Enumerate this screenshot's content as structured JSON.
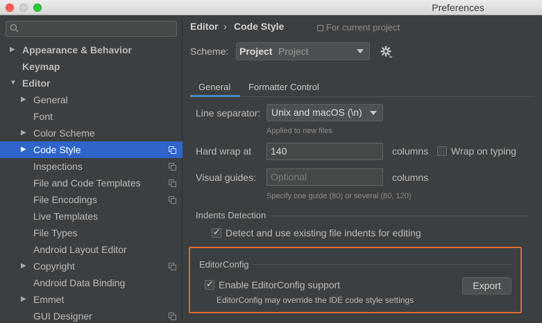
{
  "window": {
    "title": "Preferences"
  },
  "sidebar": {
    "search_placeholder": "",
    "items": [
      {
        "label": "Appearance & Behavior",
        "arrow": "▶",
        "bold": true
      },
      {
        "label": "Keymap",
        "bold": true
      },
      {
        "label": "Editor",
        "arrow": "▼",
        "bold": true
      },
      {
        "label": "General",
        "arrow": "▶"
      },
      {
        "label": "Font"
      },
      {
        "label": "Color Scheme",
        "arrow": "▶"
      },
      {
        "label": "Code Style",
        "arrow": "▶",
        "selected": true,
        "copy_icon": "copy-icon"
      },
      {
        "label": "Inspections",
        "copy_icon": "copy-icon"
      },
      {
        "label": "File and Code Templates",
        "copy_icon": "copy-icon"
      },
      {
        "label": "File Encodings",
        "copy_icon": "copy-icon"
      },
      {
        "label": "Live Templates"
      },
      {
        "label": "File Types"
      },
      {
        "label": "Android Layout Editor"
      },
      {
        "label": "Copyright",
        "arrow": "▶",
        "copy_icon": "copy-icon"
      },
      {
        "label": "Android Data Binding"
      },
      {
        "label": "Emmet",
        "arrow": "▶"
      },
      {
        "label": "GUI Designer",
        "copy_icon": "copy-icon"
      }
    ]
  },
  "header": {
    "breadcrumb_1": "Editor",
    "breadcrumb_sep": "›",
    "breadcrumb_2": "Code Style",
    "project_note": "For current project"
  },
  "scheme": {
    "label": "Scheme:",
    "value_bold": "Project",
    "value_sub": "Project"
  },
  "tabs": [
    {
      "label": "General",
      "active": true
    },
    {
      "label": "Formatter Control",
      "active": false
    }
  ],
  "general": {
    "line_separator_label": "Line separator:",
    "line_separator_value": "Unix and macOS (\\n)",
    "line_separator_hint": "Applied to new files",
    "hard_wrap_label": "Hard wrap at",
    "hard_wrap_value": "140",
    "hard_wrap_unit": "columns",
    "wrap_on_typing_label": "Wrap on typing",
    "wrap_on_typing_checked": false,
    "visual_guides_label": "Visual guides:",
    "visual_guides_placeholder": "Optional",
    "visual_guides_unit": "columns",
    "visual_guides_hint": "Specify one guide (80) or several (80, 120)",
    "indents_section": "Indents Detection",
    "detect_indents_label": "Detect and use existing file indents for editing",
    "detect_indents_checked": true
  },
  "editorconfig": {
    "section": "EditorConfig",
    "enable_label": "Enable EditorConfig support",
    "enable_checked": true,
    "hint": "EditorConfig may override the IDE code style settings",
    "export_label": "Export"
  },
  "colors": {
    "background": "#3c3f41",
    "selection": "#2f65ca",
    "highlight_border": "#e06c28",
    "tab_underline": "#4a88c7"
  }
}
